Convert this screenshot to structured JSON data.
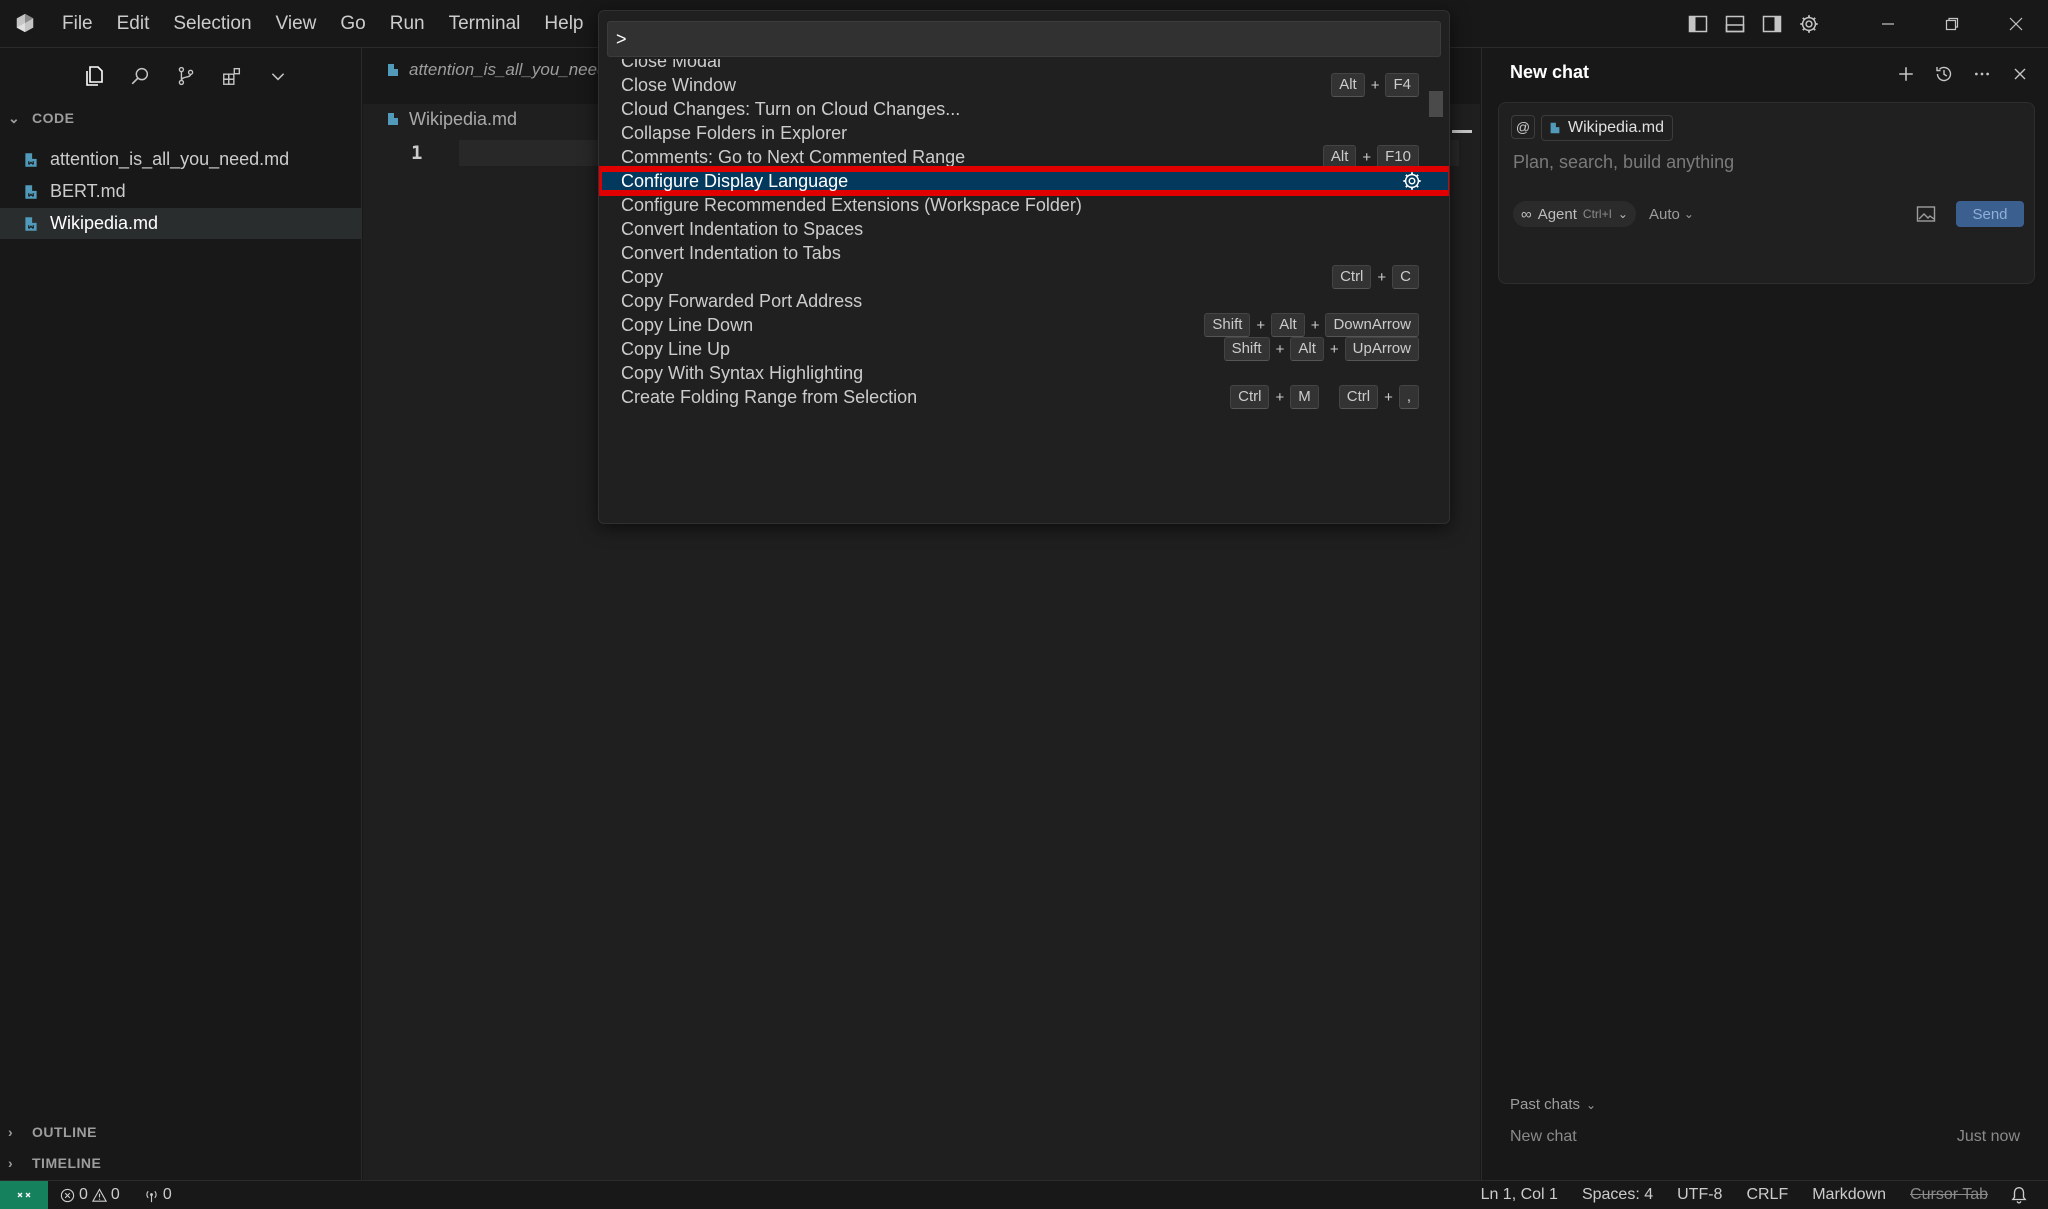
{
  "menu": [
    "File",
    "Edit",
    "Selection",
    "View",
    "Go",
    "Run",
    "Terminal",
    "Help"
  ],
  "explorer": {
    "section_title": "CODE",
    "files": [
      "attention_is_all_you_need.md",
      "BERT.md",
      "Wikipedia.md"
    ],
    "selected_file": "Wikipedia.md",
    "outline_title": "OUTLINE",
    "timeline_title": "TIMELINE"
  },
  "editor": {
    "tab_label": "attention_is_all_you_need.md",
    "breadcrumb": "Wikipedia.md",
    "line_number": "1"
  },
  "palette": {
    "input_value": ">",
    "commands": [
      {
        "label": "Close Modal",
        "keys": []
      },
      {
        "label": "Close Window",
        "keys": [
          [
            "Alt",
            "F4"
          ]
        ]
      },
      {
        "label": "Cloud Changes: Turn on Cloud Changes...",
        "keys": []
      },
      {
        "label": "Collapse Folders in Explorer",
        "keys": []
      },
      {
        "label": "Comments: Go to Next Commented Range",
        "keys": [
          [
            "Alt",
            "F10"
          ]
        ]
      },
      {
        "label": "Configure Display Language",
        "keys": [],
        "selected": true,
        "action_icon": "gear-icon"
      },
      {
        "label": "Configure Recommended Extensions (Workspace Folder)",
        "keys": []
      },
      {
        "label": "Convert Indentation to Spaces",
        "keys": []
      },
      {
        "label": "Convert Indentation to Tabs",
        "keys": []
      },
      {
        "label": "Copy",
        "keys": [
          [
            "Ctrl",
            "C"
          ]
        ]
      },
      {
        "label": "Copy Forwarded Port Address",
        "keys": []
      },
      {
        "label": "Copy Line Down",
        "keys": [
          [
            "Shift",
            "Alt",
            "DownArrow"
          ]
        ]
      },
      {
        "label": "Copy Line Up",
        "keys": [
          [
            "Shift",
            "Alt",
            "UpArrow"
          ]
        ]
      },
      {
        "label": "Copy With Syntax Highlighting",
        "keys": []
      },
      {
        "label": "Create Folding Range from Selection",
        "keys": [
          [
            "Ctrl",
            "M"
          ],
          [
            "Ctrl",
            ","
          ]
        ]
      }
    ]
  },
  "chat": {
    "title": "New chat",
    "at_label": "@",
    "context_file": "Wikipedia.md",
    "placeholder": "Plan, search, build anything",
    "agent_label": "Agent",
    "agent_shortcut": "Ctrl+I",
    "model_label": "Auto",
    "send_label": "Send",
    "past_chats_label": "Past chats",
    "past_chat_title": "New chat",
    "past_chat_time": "Just now"
  },
  "status": {
    "errors": "0",
    "warnings": "0",
    "ports": "0",
    "position": "Ln 1, Col 1",
    "spaces": "Spaces: 4",
    "encoding": "UTF-8",
    "eol": "CRLF",
    "language": "Markdown",
    "cursor_tab": "Cursor Tab"
  },
  "colors": {
    "accent": "#16825d",
    "highlight_box": "#e00000",
    "selection": "#04395e",
    "markdown_icon": "#519aba"
  }
}
